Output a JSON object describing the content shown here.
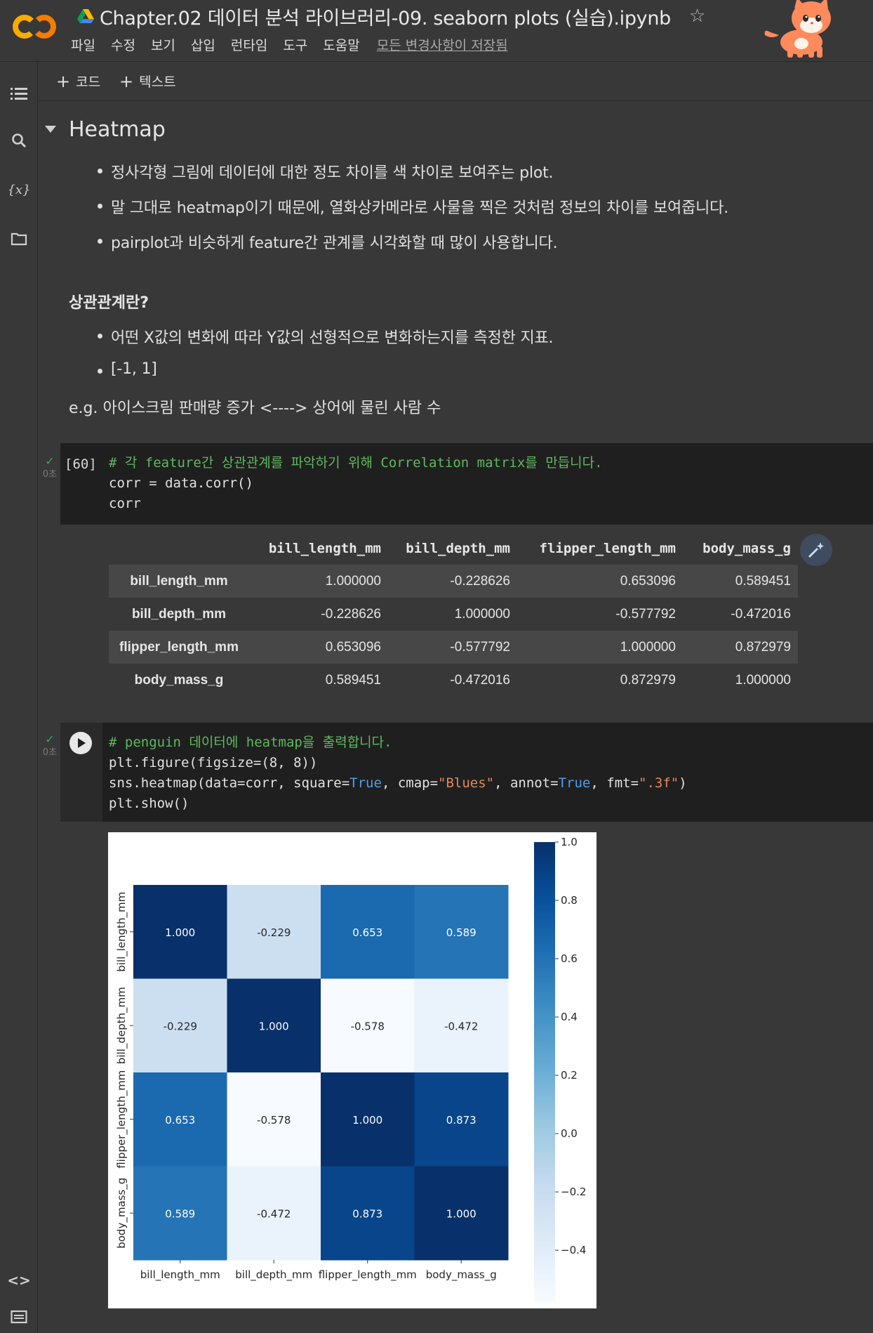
{
  "app": {
    "logo_text": "CO",
    "title": "Chapter.02 데이터 분석 라이브러리-09. seaborn plots (실습).ipynb",
    "menu": [
      "파일",
      "수정",
      "보기",
      "삽입",
      "런타임",
      "도구",
      "도움말"
    ],
    "saved_status": "모든 변경사항이 저장됨"
  },
  "toolbar": {
    "add_code": "코드",
    "add_text": "텍스트"
  },
  "sidebar": [
    "toc-icon",
    "search-icon",
    "variables-icon",
    "folder-icon",
    "code-snippets-icon",
    "terminal-icon"
  ],
  "markdown": {
    "heading": "Heatmap",
    "bullets": [
      "정사각형 그림에 데이터에 대한 정도 차이를 색 차이로 보여주는 plot.",
      "말 그대로 heatmap이기 때문에, 열화상카메라로 사물을 찍은 것처럼 정보의 차이를 보여줍니다.",
      "pairplot과 비슷하게 feature간 관계를 시각화할 때 많이 사용합니다."
    ],
    "subheading": "상관관계란?",
    "sub_bullets": [
      "어떤 X값의 변화에 따라 Y값의 선형적으로 변화하는지를 측정한 지표.",
      "[-1, 1]"
    ],
    "example": "e.g. 아이스크림 판매량 증가 <----> 상어에 물린 사람 수"
  },
  "cell1": {
    "status": "0초",
    "exec_count": "[60]",
    "comment": "# 각 feature간 상관관계를 파악하기 위해 Correlation matrix를 만듭니다.",
    "line2": "corr = data.corr()",
    "line3": "corr"
  },
  "dataframe": {
    "columns": [
      "bill_length_mm",
      "bill_depth_mm",
      "flipper_length_mm",
      "body_mass_g"
    ],
    "rows": [
      {
        "index": "bill_length_mm",
        "values": [
          "1.000000",
          "-0.228626",
          "0.653096",
          "0.589451"
        ]
      },
      {
        "index": "bill_depth_mm",
        "values": [
          "-0.228626",
          "1.000000",
          "-0.577792",
          "-0.472016"
        ]
      },
      {
        "index": "flipper_length_mm",
        "values": [
          "0.653096",
          "-0.577792",
          "1.000000",
          "0.872979"
        ]
      },
      {
        "index": "body_mass_g",
        "values": [
          "0.589451",
          "-0.472016",
          "0.872979",
          "1.000000"
        ]
      }
    ]
  },
  "cell2": {
    "status": "0초",
    "comment": "# penguin 데이터에 heatmap을 출력합니다.",
    "line2": "plt.figure(figsize=(8, 8))",
    "line3_a": "sns.heatmap(data=corr, square=",
    "line3_kw1": "True",
    "line3_b": ", cmap=",
    "line3_str1": "\"Blues\"",
    "line3_c": ", annot=",
    "line3_kw2": "True",
    "line3_d": ", fmt=",
    "line3_str2": "\".3f\"",
    "line3_e": ")",
    "line4": "plt.show()"
  },
  "chart_data": {
    "type": "heatmap",
    "x": [
      "bill_length_mm",
      "bill_depth_mm",
      "flipper_length_mm",
      "body_mass_g"
    ],
    "y": [
      "bill_length_mm",
      "bill_depth_mm",
      "flipper_length_mm",
      "body_mass_g"
    ],
    "values": [
      [
        1.0,
        -0.229,
        0.653,
        0.589
      ],
      [
        -0.229,
        1.0,
        -0.578,
        -0.472
      ],
      [
        0.653,
        -0.578,
        1.0,
        0.873
      ],
      [
        0.589,
        -0.472,
        0.873,
        1.0
      ]
    ],
    "annotations": [
      [
        "1.000",
        "-0.229",
        "0.653",
        "0.589"
      ],
      [
        "-0.229",
        "1.000",
        "-0.578",
        "-0.472"
      ],
      [
        "0.653",
        "-0.578",
        "1.000",
        "0.873"
      ],
      [
        "0.589",
        "-0.472",
        "0.873",
        "1.000"
      ]
    ],
    "colormap": "Blues",
    "vmin": -0.578,
    "vmax": 1.0,
    "colorbar_ticks": [
      1.0,
      0.8,
      0.6,
      0.4,
      0.2,
      0.0,
      -0.2,
      -0.4
    ],
    "colorbar_tick_labels": [
      "1.0",
      "0.8",
      "0.6",
      "0.4",
      "0.2",
      "0.0",
      "−0.2",
      "−0.4"
    ]
  }
}
